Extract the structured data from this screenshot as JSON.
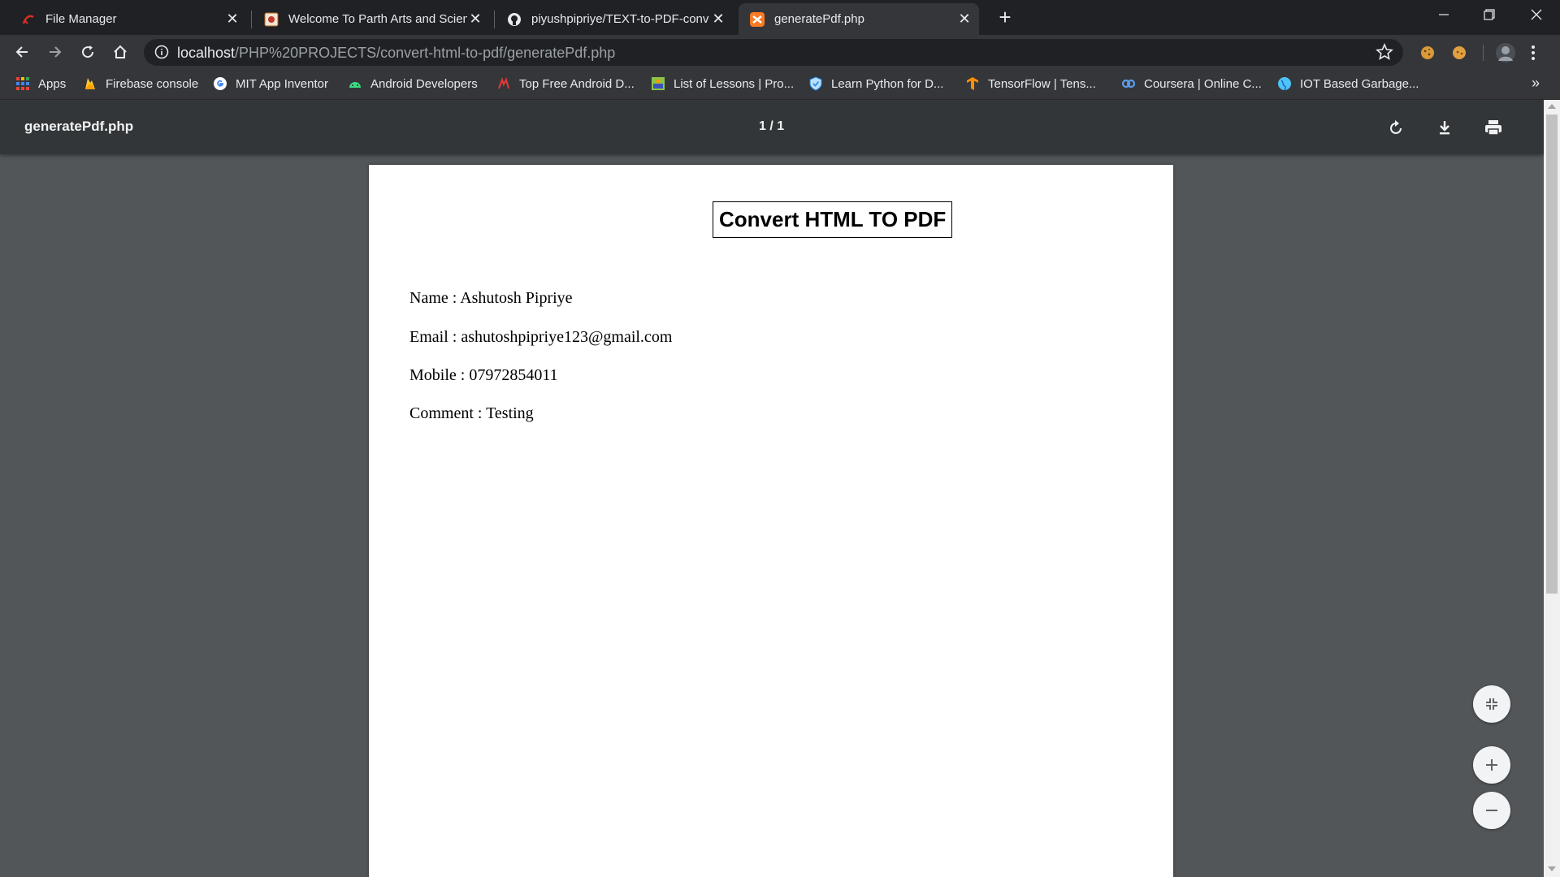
{
  "tabs": [
    {
      "title": "File Manager",
      "icon": "filemanager-icon",
      "active": false
    },
    {
      "title": "Welcome To Parth Arts and Scien",
      "icon": "parth-site-icon",
      "active": false
    },
    {
      "title": "piyushpipriye/TEXT-to-PDF-conv",
      "icon": "github-icon",
      "active": false
    },
    {
      "title": "generatePdf.php",
      "icon": "xampp-icon",
      "active": true
    }
  ],
  "address": {
    "host": "localhost",
    "path": "/PHP%20PROJECTS/convert-html-to-pdf/generatePdf.php"
  },
  "bookmarks": [
    {
      "label": "Apps",
      "icon": "apps-grid-icon"
    },
    {
      "label": "Firebase console",
      "icon": "firebase-icon"
    },
    {
      "label": "MIT App Inventor",
      "icon": "google-icon"
    },
    {
      "label": "Android Developers",
      "icon": "android-icon"
    },
    {
      "label": "Top Free Android D...",
      "icon": "app-brain-icon"
    },
    {
      "label": "List of Lessons | Pro...",
      "icon": "lessons-icon"
    },
    {
      "label": "Learn Python for D...",
      "icon": "shield-site-icon"
    },
    {
      "label": "TensorFlow  |  Tens...",
      "icon": "tensorflow-icon"
    },
    {
      "label": "Coursera | Online C...",
      "icon": "coursera-icon"
    },
    {
      "label": "IOT Based Garbage...",
      "icon": "globe-icon"
    }
  ],
  "pdf": {
    "filename": "generatePdf.php",
    "page_indicator": "1 / 1",
    "document": {
      "title": "Convert HTML TO PDF",
      "fields": [
        "Name : Ashutosh Pipriye",
        "Email : ashutoshpipriye123@gmail.com",
        "Mobile : 07972854011",
        "Comment : Testing"
      ]
    }
  },
  "colors": {
    "browser_frame": "#202124",
    "toolbar": "#35363a",
    "pdf_toolbar": "#323639",
    "pdf_background": "#525659",
    "page": "#ffffff"
  }
}
